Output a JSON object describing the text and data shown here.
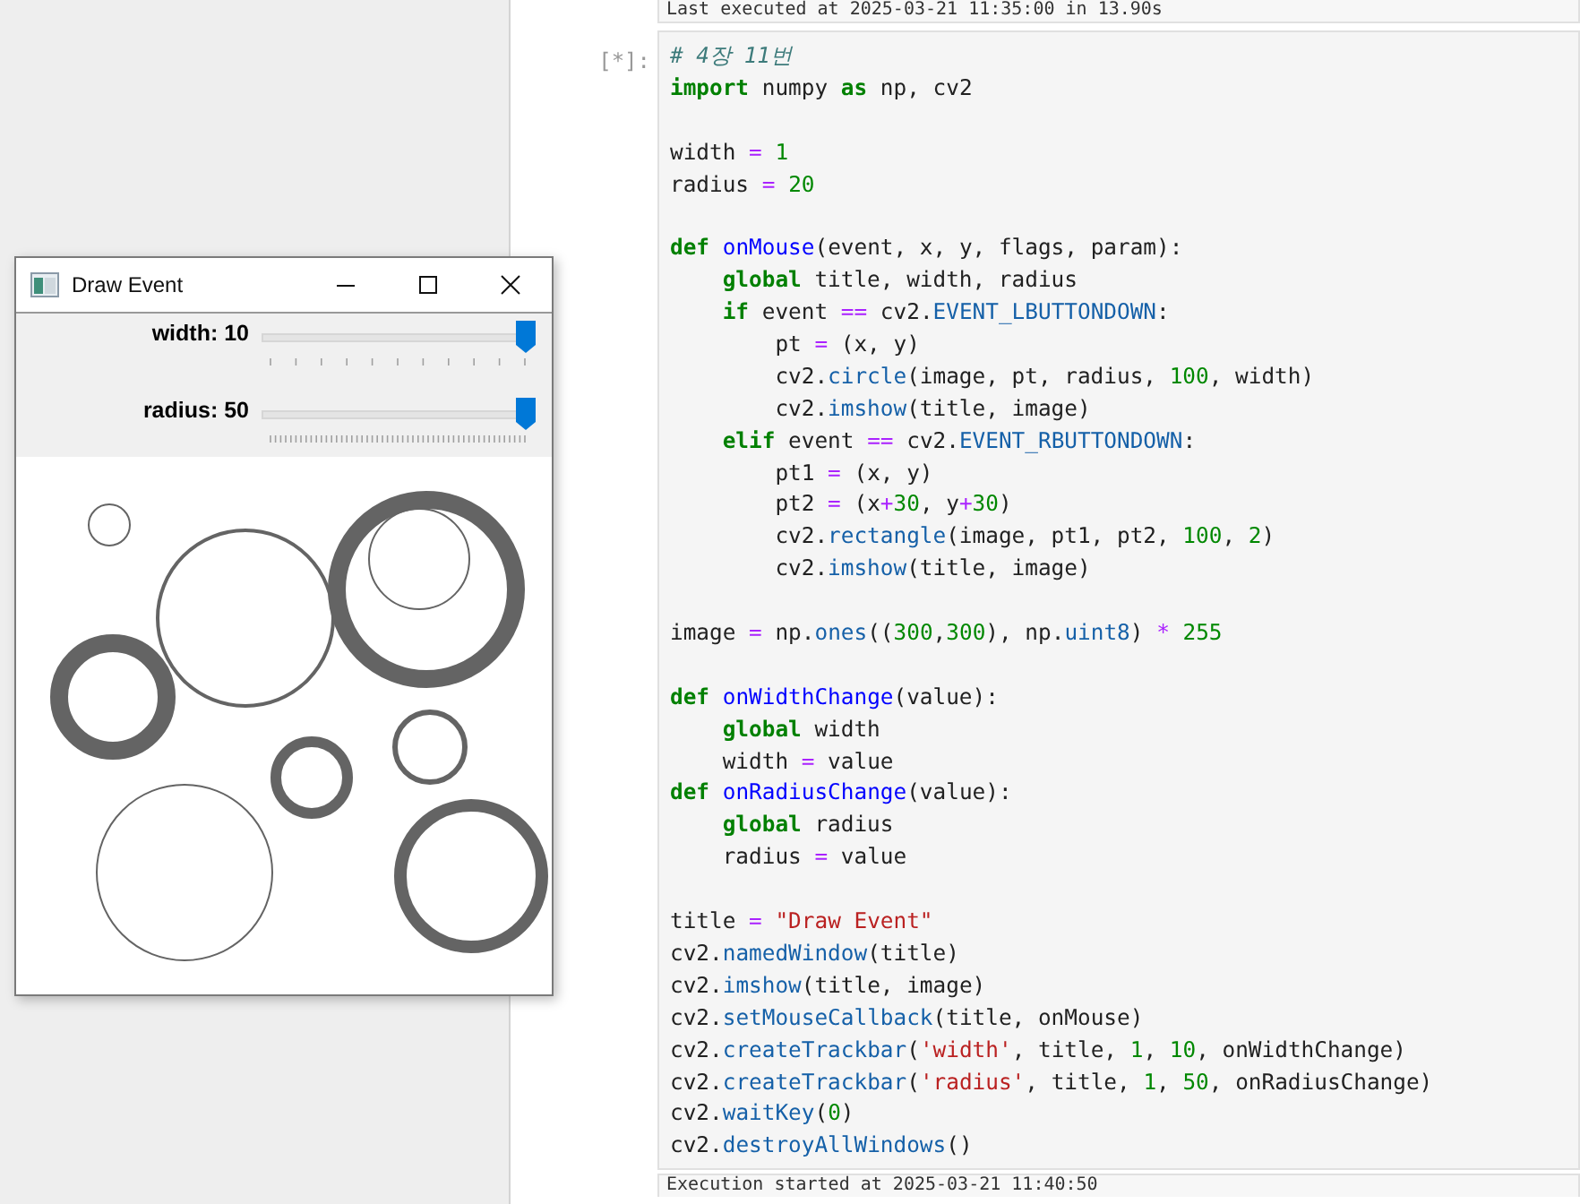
{
  "notebook": {
    "previous_status": "Last executed at 2025-03-21 11:35:00 in 13.90s",
    "cell": {
      "prompt": "[*]:",
      "blocks": [
        [
          {
            "tokens": [
              {
                "kind": "comment",
                "text": "# 4장 11번"
              }
            ]
          },
          {
            "tokens": [
              {
                "kind": "keyword",
                "text": "import"
              },
              {
                "kind": "plain",
                "text": " numpy "
              },
              {
                "kind": "keyword",
                "text": "as"
              },
              {
                "kind": "plain",
                "text": " np, cv2"
              }
            ]
          }
        ],
        [
          {
            "tokens": [
              {
                "kind": "plain",
                "text": "width "
              },
              {
                "kind": "operator",
                "text": "= "
              },
              {
                "kind": "number",
                "text": "1"
              }
            ]
          },
          {
            "tokens": [
              {
                "kind": "plain",
                "text": "radius "
              },
              {
                "kind": "operator",
                "text": "= "
              },
              {
                "kind": "number",
                "text": "20"
              }
            ]
          }
        ],
        [
          {
            "tokens": [
              {
                "kind": "keyword",
                "text": "def "
              },
              {
                "kind": "function",
                "text": "onMouse"
              },
              {
                "kind": "plain",
                "text": "(event, x, y, flags, param):"
              }
            ],
            "children": [
              {
                "tokens": [
                  {
                    "kind": "keyword",
                    "text": "global"
                  },
                  {
                    "kind": "plain",
                    "text": " title, width, radius"
                  }
                ]
              },
              {
                "tokens": [
                  {
                    "kind": "keyword",
                    "text": "if"
                  },
                  {
                    "kind": "plain",
                    "text": " event "
                  },
                  {
                    "kind": "operator",
                    "text": "=="
                  },
                  {
                    "kind": "plain",
                    "text": " cv2."
                  },
                  {
                    "kind": "attribute",
                    "text": "EVENT_LBUTTONDOWN"
                  },
                  {
                    "kind": "plain",
                    "text": ":"
                  }
                ],
                "children": [
                  {
                    "tokens": [
                      {
                        "kind": "plain",
                        "text": "pt "
                      },
                      {
                        "kind": "operator",
                        "text": "="
                      },
                      {
                        "kind": "plain",
                        "text": " (x, y)"
                      }
                    ]
                  },
                  {
                    "tokens": [
                      {
                        "kind": "plain",
                        "text": "cv2."
                      },
                      {
                        "kind": "attribute",
                        "text": "circle"
                      },
                      {
                        "kind": "plain",
                        "text": "(image, pt, radius, "
                      },
                      {
                        "kind": "number",
                        "text": "100"
                      },
                      {
                        "kind": "plain",
                        "text": ", width)"
                      }
                    ]
                  },
                  {
                    "tokens": [
                      {
                        "kind": "plain",
                        "text": "cv2."
                      },
                      {
                        "kind": "attribute",
                        "text": "imshow"
                      },
                      {
                        "kind": "plain",
                        "text": "(title, image)"
                      }
                    ]
                  }
                ]
              },
              {
                "tokens": [
                  {
                    "kind": "keyword",
                    "text": "elif"
                  },
                  {
                    "kind": "plain",
                    "text": " event "
                  },
                  {
                    "kind": "operator",
                    "text": "=="
                  },
                  {
                    "kind": "plain",
                    "text": " cv2."
                  },
                  {
                    "kind": "attribute",
                    "text": "EVENT_RBUTTONDOWN"
                  },
                  {
                    "kind": "plain",
                    "text": ":"
                  }
                ],
                "children": [
                  {
                    "tokens": [
                      {
                        "kind": "plain",
                        "text": "pt1 "
                      },
                      {
                        "kind": "operator",
                        "text": "="
                      },
                      {
                        "kind": "plain",
                        "text": " (x, y)"
                      }
                    ]
                  },
                  {
                    "tokens": [
                      {
                        "kind": "plain",
                        "text": "pt2 "
                      },
                      {
                        "kind": "operator",
                        "text": "="
                      },
                      {
                        "kind": "plain",
                        "text": " (x"
                      },
                      {
                        "kind": "operator",
                        "text": "+"
                      },
                      {
                        "kind": "number",
                        "text": "30"
                      },
                      {
                        "kind": "plain",
                        "text": ", y"
                      },
                      {
                        "kind": "operator",
                        "text": "+"
                      },
                      {
                        "kind": "number",
                        "text": "30"
                      },
                      {
                        "kind": "plain",
                        "text": ")"
                      }
                    ]
                  },
                  {
                    "tokens": [
                      {
                        "kind": "plain",
                        "text": "cv2."
                      },
                      {
                        "kind": "attribute",
                        "text": "rectangle"
                      },
                      {
                        "kind": "plain",
                        "text": "(image, pt1, pt2, "
                      },
                      {
                        "kind": "number",
                        "text": "100"
                      },
                      {
                        "kind": "plain",
                        "text": ", "
                      },
                      {
                        "kind": "number",
                        "text": "2"
                      },
                      {
                        "kind": "plain",
                        "text": ")"
                      }
                    ]
                  },
                  {
                    "tokens": [
                      {
                        "kind": "plain",
                        "text": "cv2."
                      },
                      {
                        "kind": "attribute",
                        "text": "imshow"
                      },
                      {
                        "kind": "plain",
                        "text": "(title, image)"
                      }
                    ]
                  }
                ]
              }
            ]
          }
        ],
        [
          {
            "tokens": [
              {
                "kind": "plain",
                "text": "image "
              },
              {
                "kind": "operator",
                "text": "="
              },
              {
                "kind": "plain",
                "text": " np."
              },
              {
                "kind": "attribute",
                "text": "ones"
              },
              {
                "kind": "plain",
                "text": "(("
              },
              {
                "kind": "number",
                "text": "300"
              },
              {
                "kind": "plain",
                "text": ","
              },
              {
                "kind": "number",
                "text": "300"
              },
              {
                "kind": "plain",
                "text": "), np."
              },
              {
                "kind": "attribute",
                "text": "uint8"
              },
              {
                "kind": "plain",
                "text": ") "
              },
              {
                "kind": "operator",
                "text": "* "
              },
              {
                "kind": "number",
                "text": "255"
              }
            ]
          }
        ],
        [
          {
            "tokens": [
              {
                "kind": "keyword",
                "text": "def "
              },
              {
                "kind": "function",
                "text": "onWidthChange"
              },
              {
                "kind": "plain",
                "text": "(value):"
              }
            ],
            "children": [
              {
                "tokens": [
                  {
                    "kind": "keyword",
                    "text": "global"
                  },
                  {
                    "kind": "plain",
                    "text": " width"
                  }
                ]
              },
              {
                "tokens": [
                  {
                    "kind": "plain",
                    "text": "width "
                  },
                  {
                    "kind": "operator",
                    "text": "="
                  },
                  {
                    "kind": "plain",
                    "text": " value"
                  }
                ]
              }
            ]
          },
          {
            "tokens": [
              {
                "kind": "keyword",
                "text": "def "
              },
              {
                "kind": "function",
                "text": "onRadiusChange"
              },
              {
                "kind": "plain",
                "text": "(value):"
              }
            ],
            "children": [
              {
                "tokens": [
                  {
                    "kind": "keyword",
                    "text": "global"
                  },
                  {
                    "kind": "plain",
                    "text": " radius"
                  }
                ]
              },
              {
                "tokens": [
                  {
                    "kind": "plain",
                    "text": "radius "
                  },
                  {
                    "kind": "operator",
                    "text": "="
                  },
                  {
                    "kind": "plain",
                    "text": " value"
                  }
                ]
              }
            ]
          }
        ],
        [
          {
            "tokens": [
              {
                "kind": "plain",
                "text": "title "
              },
              {
                "kind": "operator",
                "text": "= "
              },
              {
                "kind": "string",
                "text": "\"Draw Event\""
              }
            ]
          },
          {
            "tokens": [
              {
                "kind": "plain",
                "text": "cv2."
              },
              {
                "kind": "attribute",
                "text": "namedWindow"
              },
              {
                "kind": "plain",
                "text": "(title)"
              }
            ]
          },
          {
            "tokens": [
              {
                "kind": "plain",
                "text": "cv2."
              },
              {
                "kind": "attribute",
                "text": "imshow"
              },
              {
                "kind": "plain",
                "text": "(title, image)"
              }
            ]
          },
          {
            "tokens": [
              {
                "kind": "plain",
                "text": "cv2."
              },
              {
                "kind": "attribute",
                "text": "setMouseCallback"
              },
              {
                "kind": "plain",
                "text": "(title, onMouse)"
              }
            ]
          },
          {
            "tokens": [
              {
                "kind": "plain",
                "text": "cv2."
              },
              {
                "kind": "attribute",
                "text": "createTrackbar"
              },
              {
                "kind": "plain",
                "text": "("
              },
              {
                "kind": "string",
                "text": "'width'"
              },
              {
                "kind": "plain",
                "text": ", title, "
              },
              {
                "kind": "number",
                "text": "1"
              },
              {
                "kind": "plain",
                "text": ", "
              },
              {
                "kind": "number",
                "text": "10"
              },
              {
                "kind": "plain",
                "text": ", onWidthChange)"
              }
            ]
          },
          {
            "tokens": [
              {
                "kind": "plain",
                "text": "cv2."
              },
              {
                "kind": "attribute",
                "text": "createTrackbar"
              },
              {
                "kind": "plain",
                "text": "("
              },
              {
                "kind": "string",
                "text": "'radius'"
              },
              {
                "kind": "plain",
                "text": ", title, "
              },
              {
                "kind": "number",
                "text": "1"
              },
              {
                "kind": "plain",
                "text": ", "
              },
              {
                "kind": "number",
                "text": "50"
              },
              {
                "kind": "plain",
                "text": ", onRadiusChange)"
              }
            ]
          },
          {
            "tokens": [
              {
                "kind": "plain",
                "text": "cv2."
              },
              {
                "kind": "attribute",
                "text": "waitKey"
              },
              {
                "kind": "plain",
                "text": "("
              },
              {
                "kind": "number",
                "text": "0"
              },
              {
                "kind": "plain",
                "text": ")"
              }
            ]
          },
          {
            "tokens": [
              {
                "kind": "plain",
                "text": "cv2."
              },
              {
                "kind": "attribute",
                "text": "destroyAllWindows"
              },
              {
                "kind": "plain",
                "text": "()"
              }
            ]
          }
        ]
      ]
    },
    "next_status": "Execution started at 2025-03-21 11:40:50"
  },
  "window": {
    "title": "Draw Event",
    "trackbars": [
      {
        "label": "width: 10",
        "level": 1
      },
      {
        "label": "radius: 50",
        "level": 1
      }
    ]
  }
}
